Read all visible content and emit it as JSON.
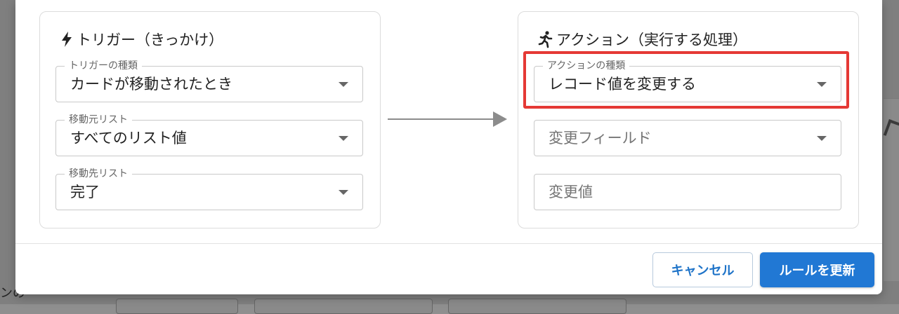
{
  "background": {
    "bottom_fragment": "ンの"
  },
  "trigger": {
    "title": "トリガー（きっかけ）",
    "fields": {
      "type": {
        "label": "トリガーの種類",
        "value": "カードが移動されたとき"
      },
      "source": {
        "label": "移動元リスト",
        "value": "すべてのリスト値"
      },
      "dest": {
        "label": "移動先リスト",
        "value": "完了"
      }
    }
  },
  "action": {
    "title": "アクション（実行する処理）",
    "fields": {
      "type": {
        "label": "アクションの種類",
        "value": "レコード値を変更する"
      },
      "field": {
        "placeholder": "変更フィールド"
      },
      "value": {
        "placeholder": "変更値"
      }
    }
  },
  "footer": {
    "cancel_label": "キャンセル",
    "update_label": "ルールを更新"
  },
  "colors": {
    "primary": "#2178d4",
    "highlight": "#e53935"
  },
  "icons": {
    "trigger": "lightning-bolt-icon",
    "action": "running-person-icon",
    "dropdown": "chevron-down-icon",
    "flow": "arrow-right-icon"
  }
}
